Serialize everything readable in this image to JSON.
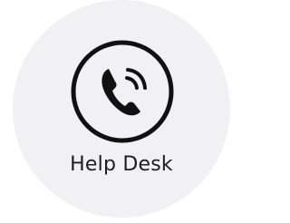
{
  "tile": {
    "label": "Help Desk",
    "icon": "phone-icon",
    "background": "#f1f1f3",
    "text_color": "#1e1e1e",
    "icon_color": "#111111"
  }
}
